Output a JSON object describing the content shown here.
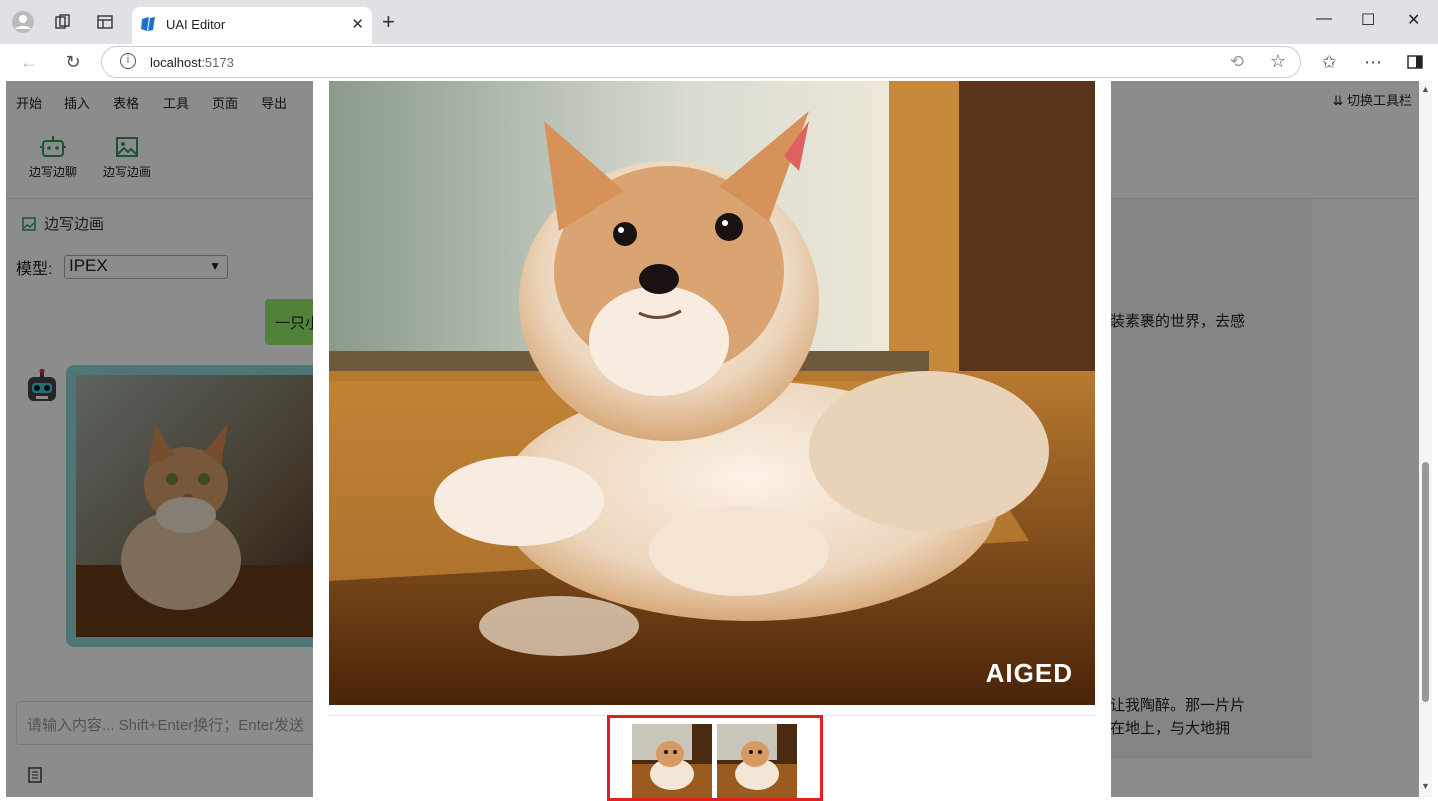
{
  "browser": {
    "tab_title": "UAI Editor",
    "url_host": "localhost",
    "url_port": ":5173"
  },
  "menu": {
    "items": [
      "开始",
      "插入",
      "表格",
      "工具",
      "页面",
      "导出"
    ],
    "toggle_toolbar": "切换工具栏"
  },
  "toolbar": {
    "chat_label": "边写边聊",
    "paint_label": "边写边画"
  },
  "panel": {
    "title": "边写边画",
    "model_label": "模型:",
    "model_value": "IPEX",
    "user_message": "一只小",
    "input_placeholder": "请输入内容... Shift+Enter换行；Enter发送"
  },
  "document": {
    "line1": "装素裹的世界，去感",
    "line2": "让我陶醉。那一片片",
    "line3": "在地上，与大地拥"
  },
  "lightbox": {
    "watermark": "AIGED"
  },
  "colors": {
    "user_bubble": "#95ec69",
    "image_frame": "#8ed8d8",
    "thumb_highlight": "#e02020",
    "icon_green": "#2e9c5a"
  }
}
